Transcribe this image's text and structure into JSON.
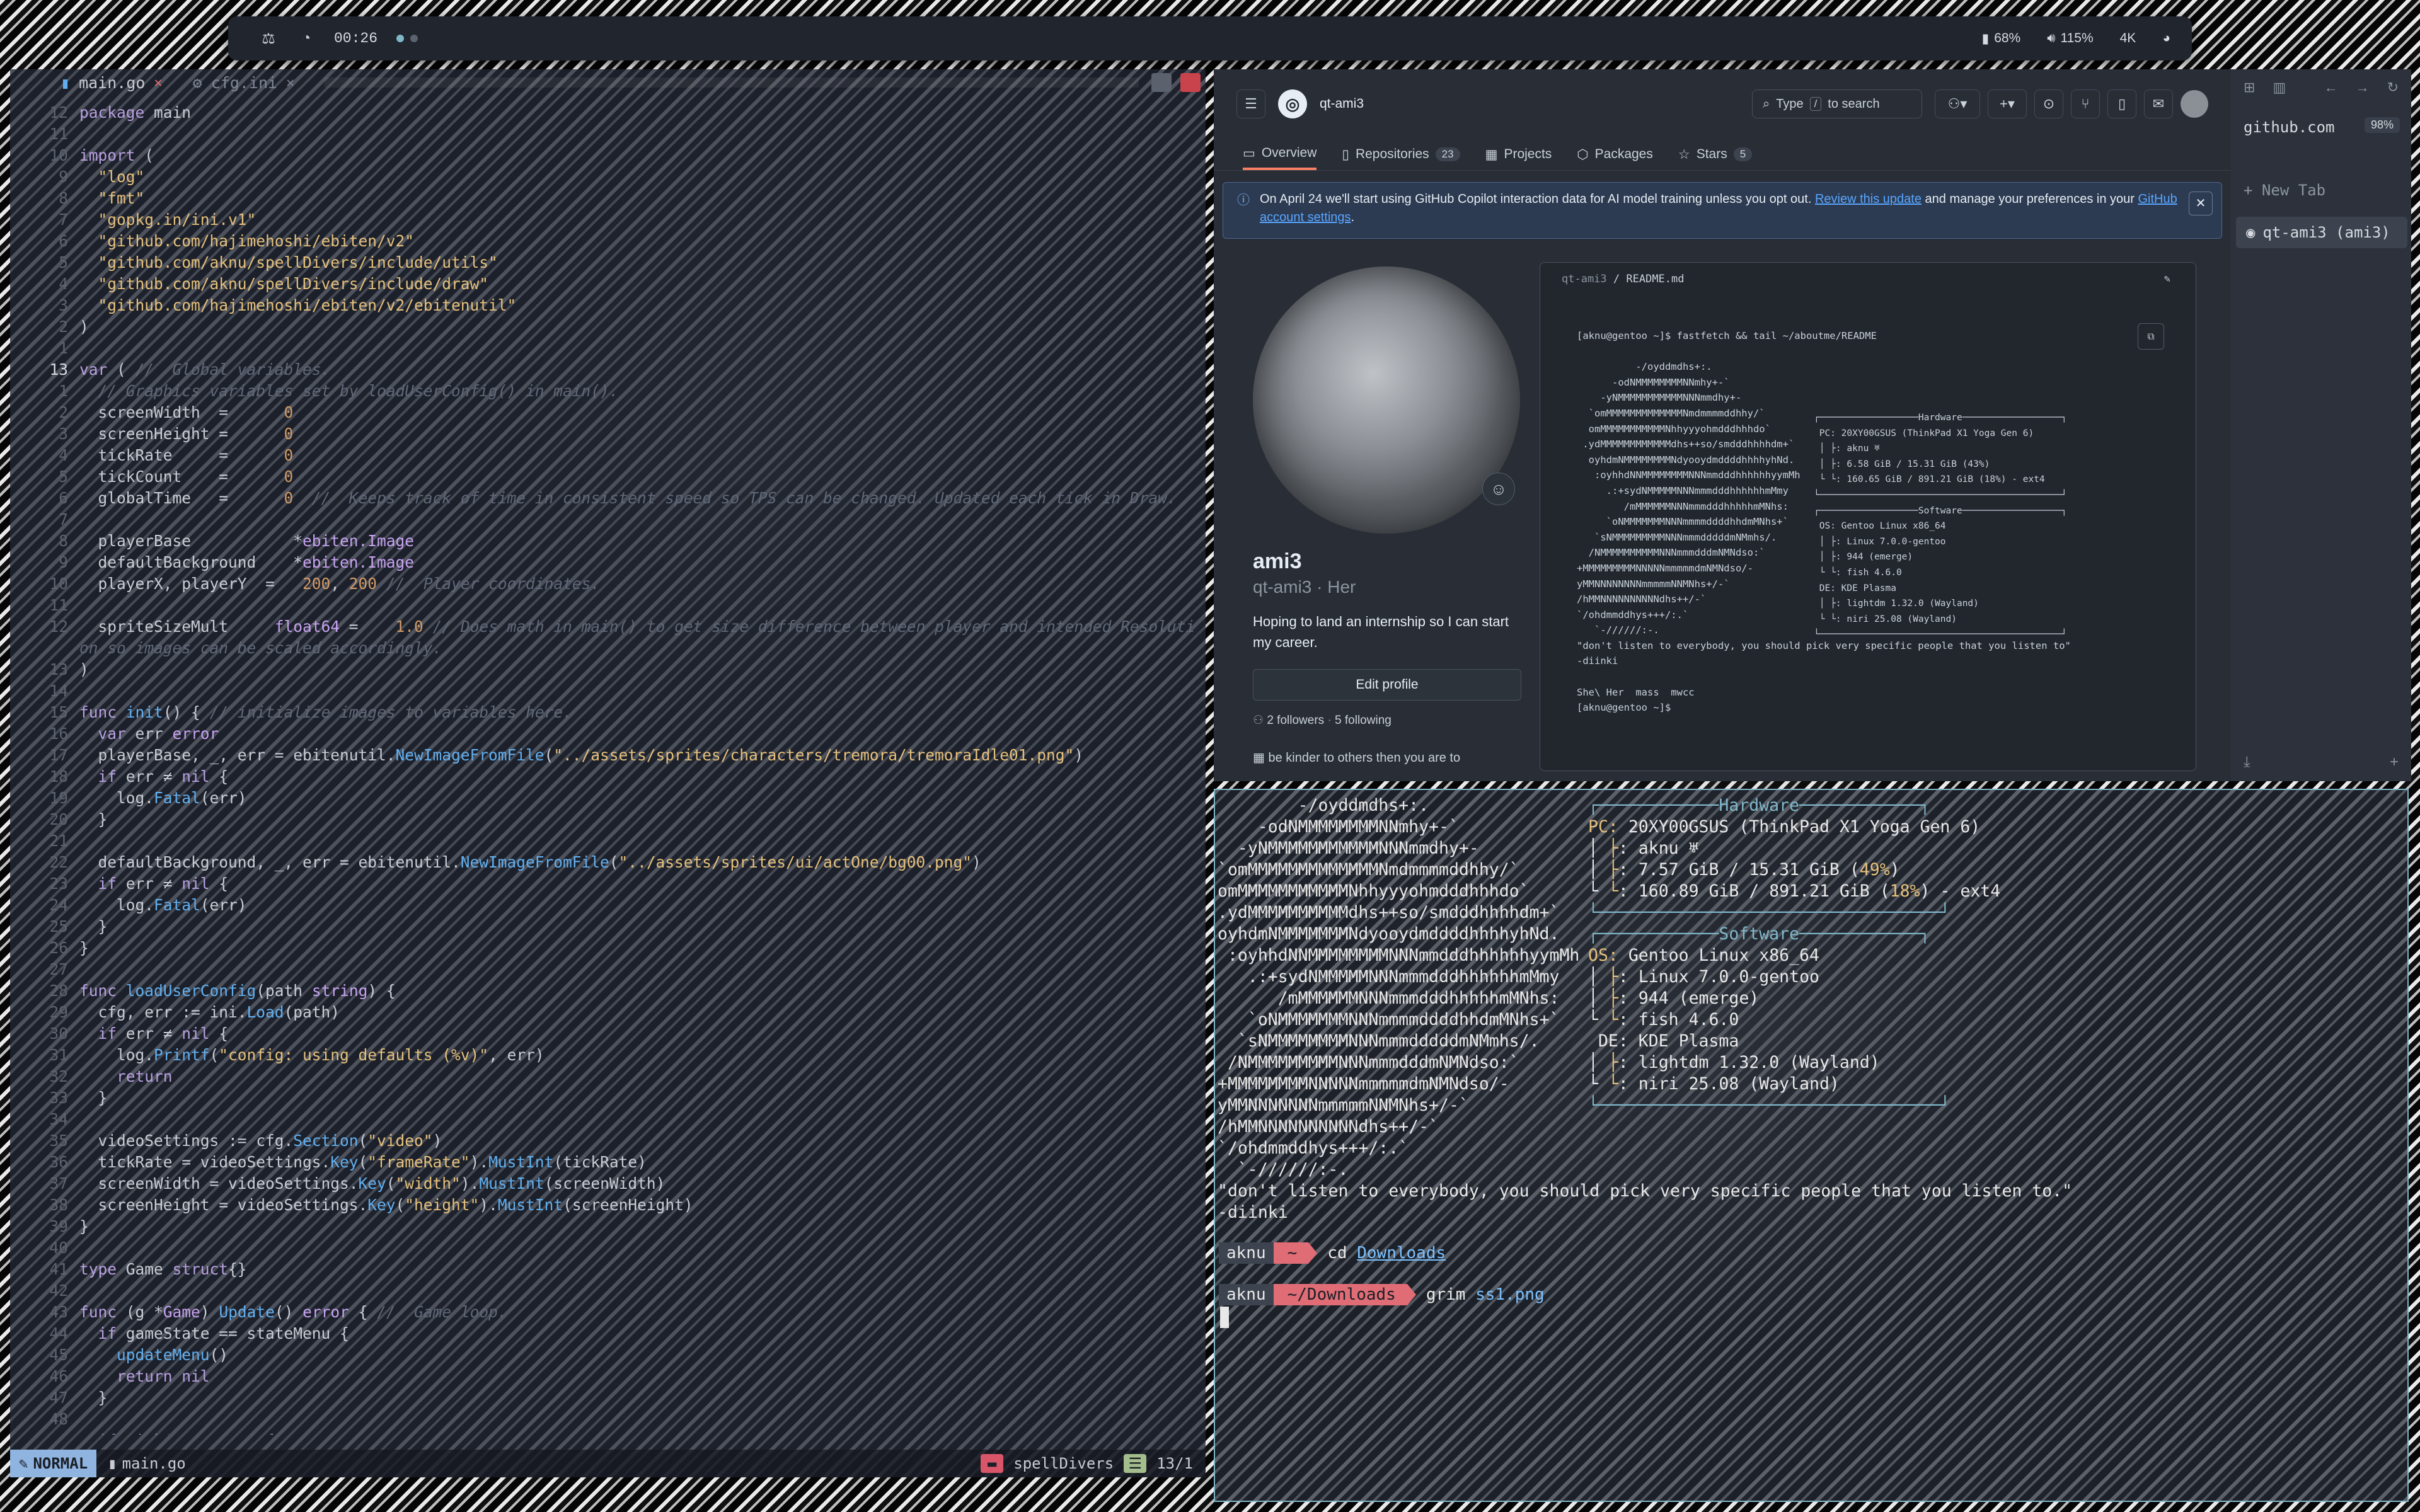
{
  "topbar": {
    "clock": "00:26",
    "battery": "68%",
    "volume": "115%",
    "resolution": "4K"
  },
  "editor": {
    "tabs": [
      {
        "label": "main.go",
        "close": "✕"
      },
      {
        "label": "cfg.ini",
        "close": "✕"
      }
    ],
    "status": {
      "mode": "NORMAL",
      "file": "main.go",
      "project": "spellDivers",
      "position": "13/1"
    }
  },
  "browser": {
    "repo_title": "qt-ami3",
    "search_text": "Type",
    "search_key": "/",
    "search_suffix": "to search",
    "nav": {
      "overview": "Overview",
      "repositories": "Repositories",
      "repositories_count": "23",
      "projects": "Projects",
      "packages": "Packages",
      "stars": "Stars",
      "stars_count": "5"
    },
    "banner": {
      "text1": "On April 24 we'll start using GitHub Copilot interaction data for AI model training unless you opt out.",
      "link1": "Review this update",
      "text2": "and manage your preferences in your",
      "link2": "GitHub account settings",
      "text3": "."
    },
    "profile": {
      "name": "ami3",
      "handle": "qt-ami3 · Her",
      "bio": "Hoping to land an internship so I can start my career.",
      "edit": "Edit profile",
      "followers": "2 followers",
      "sep": "·",
      "following": "5 following",
      "status": "be kinder to others then you are to"
    },
    "readme": {
      "crumb_user": "qt-ami3",
      "crumb_file": "README.md"
    },
    "sidebar": {
      "url": "github.com",
      "zoom": "98%",
      "new_tab": "+ New Tab",
      "tab": "qt-ami3 (ami3)"
    }
  },
  "terminal": {
    "prompt1_user": "aknu",
    "prompt1_dir": "~",
    "prompt1_cmd": "cd",
    "prompt1_arg": "Downloads",
    "prompt2_user": "aknu",
    "prompt2_dir": "~/Downloads",
    "prompt2_cmd": "grim",
    "prompt2_arg": "ss1.png"
  },
  "colors": {
    "accent": "#7fb7c9",
    "error": "#e06c75",
    "mode": "#8fb4e0",
    "link": "#58a6ff"
  }
}
